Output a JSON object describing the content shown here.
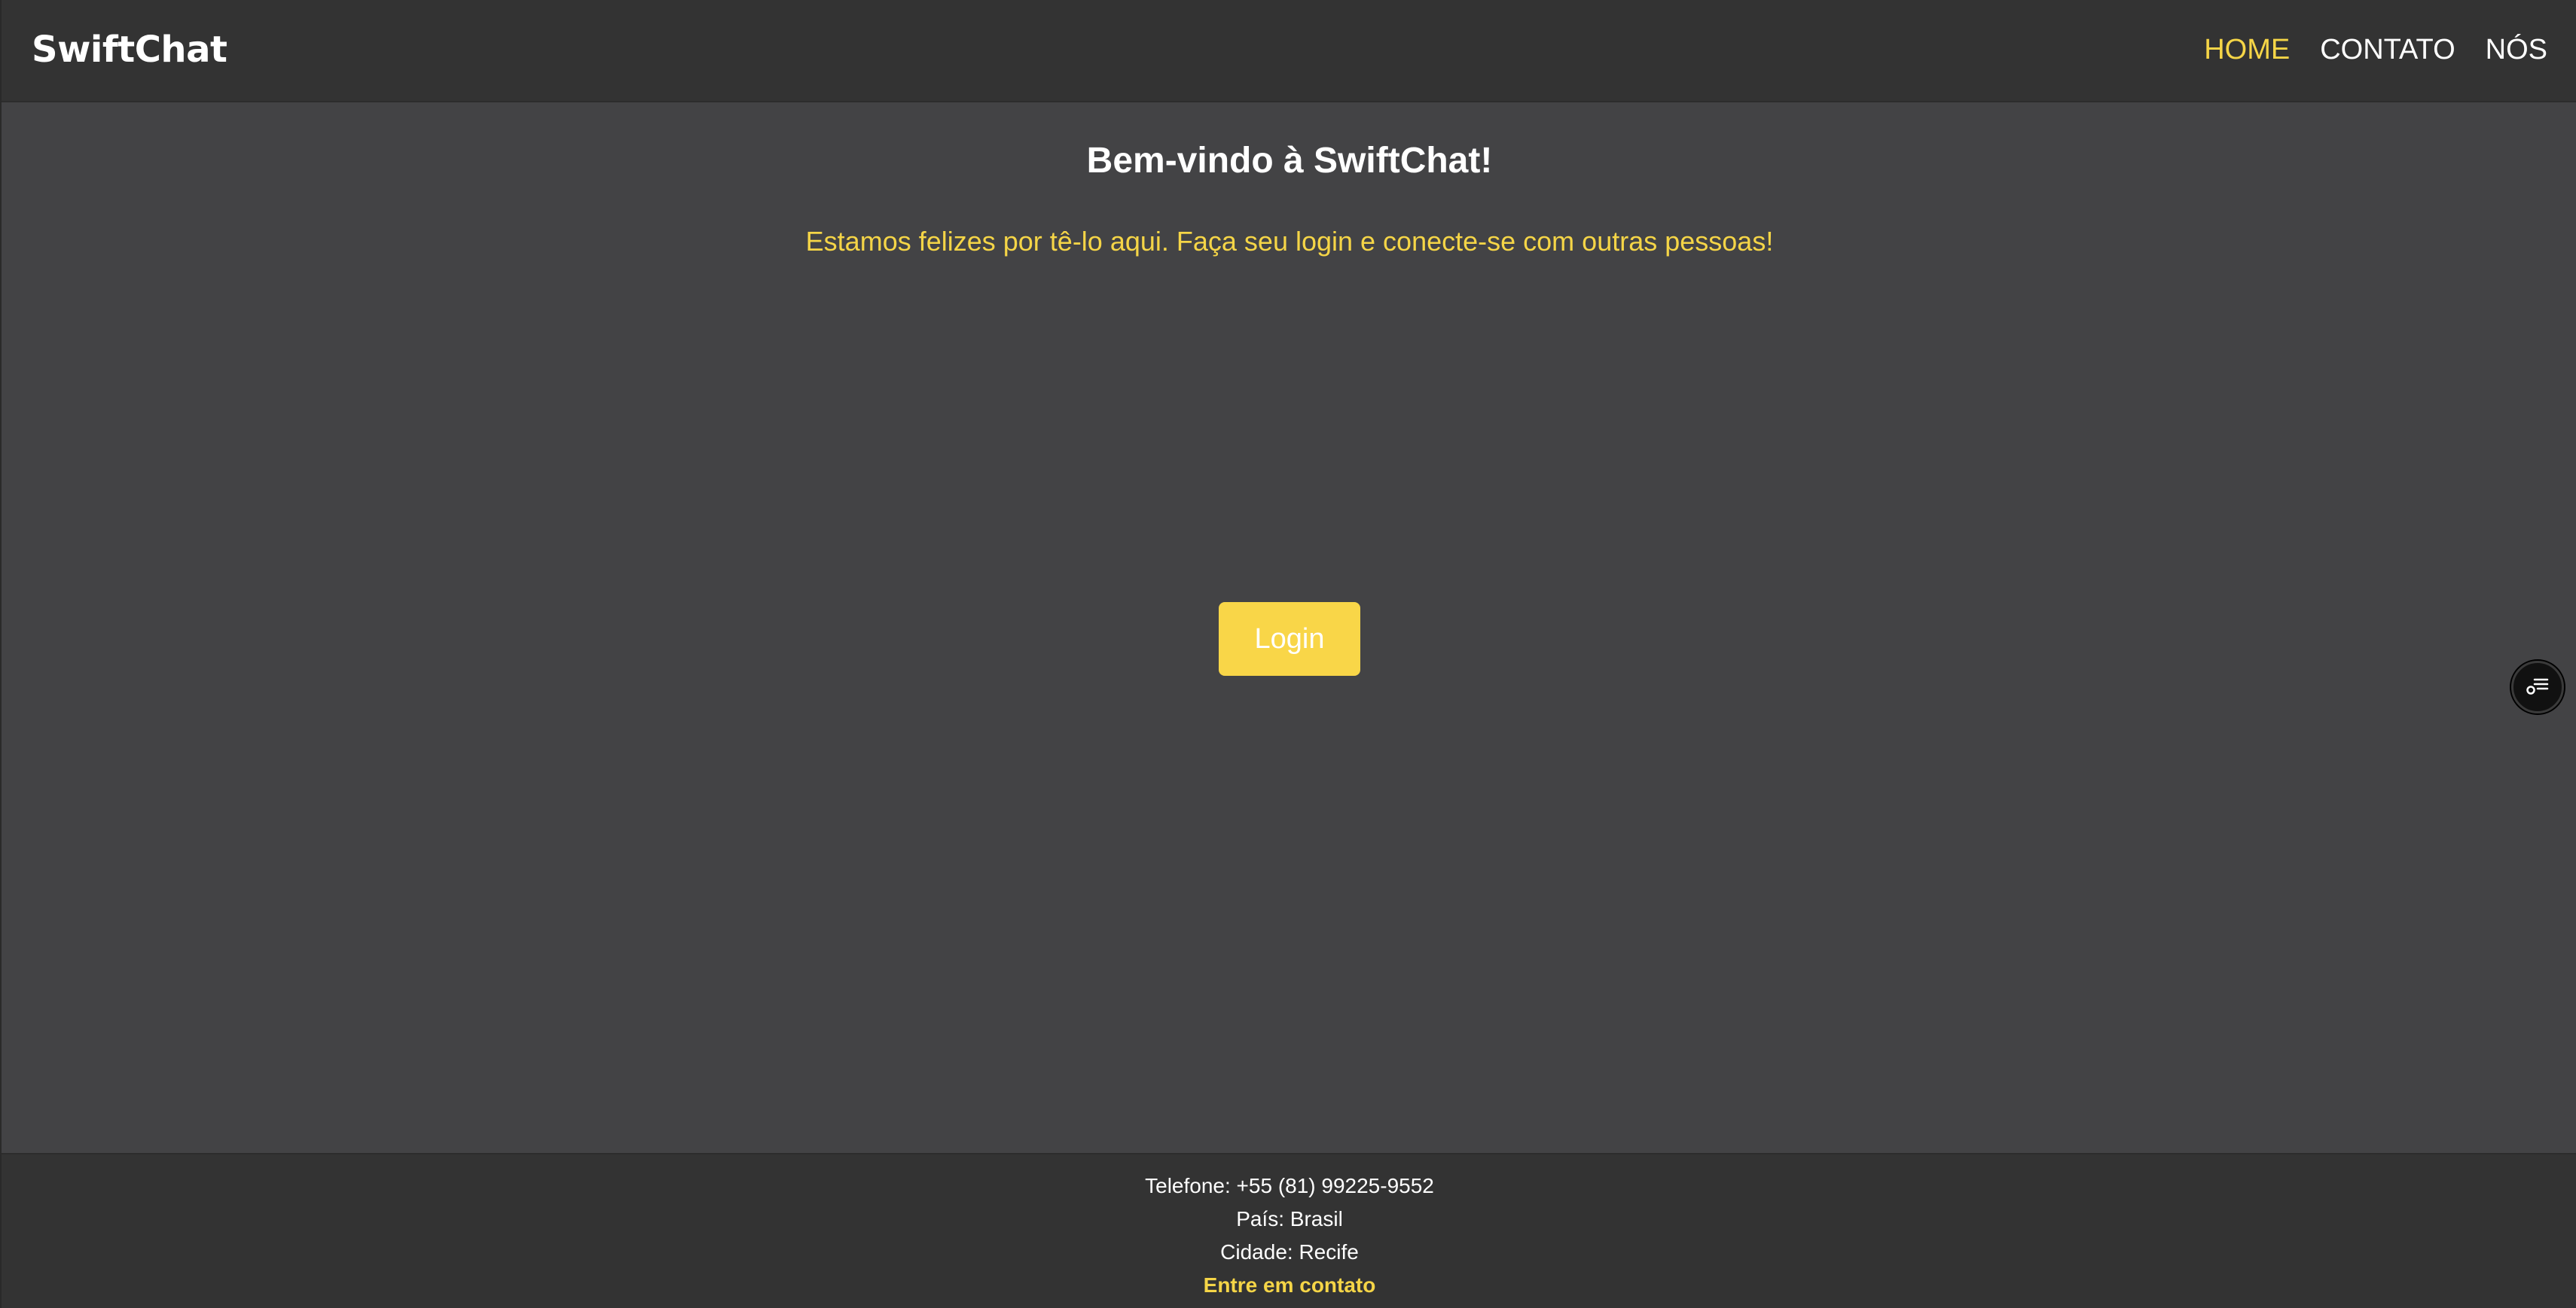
{
  "header": {
    "brand": "SwiftChat",
    "nav": [
      {
        "label": "HOME",
        "active": true
      },
      {
        "label": "CONTATO",
        "active": false
      },
      {
        "label": "NÓS",
        "active": false
      }
    ]
  },
  "main": {
    "title": "Bem-vindo à SwiftChat!",
    "subtitle": "Estamos felizes por tê-lo aqui. Faça seu login e conecte-se com outras pessoas!",
    "login_label": "Login"
  },
  "floating_button": {
    "icon": "filter-list-icon"
  },
  "footer": {
    "phone": "Telefone: +55 (81) 99225-9552",
    "country": "País: Brasil",
    "city": "Cidade: Recife",
    "contact_link": "Entre em contato"
  },
  "colors": {
    "accent": "#f5d547",
    "header_bg": "#333333",
    "body_bg": "#434345",
    "button_bg": "#f9d648"
  }
}
